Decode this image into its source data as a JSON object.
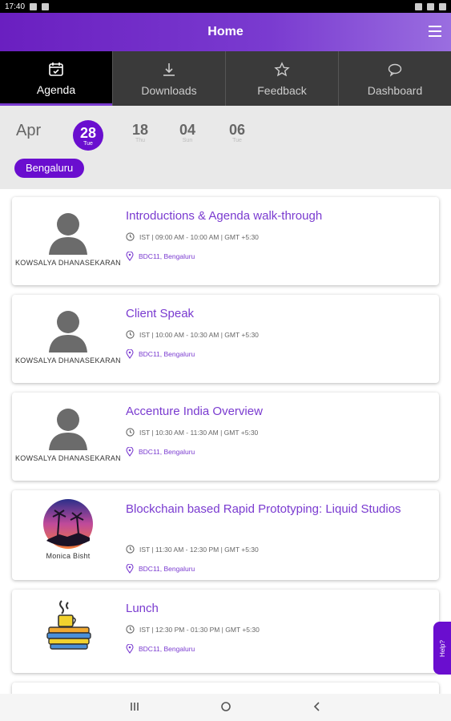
{
  "status_bar": {
    "time": "17:40"
  },
  "app_bar": {
    "title": "Home"
  },
  "tabs": [
    {
      "label": "Agenda",
      "icon": "calendar-icon",
      "active": true
    },
    {
      "label": "Downloads",
      "icon": "download-icon",
      "active": false
    },
    {
      "label": "Feedback",
      "icon": "star-icon",
      "active": false
    },
    {
      "label": "Dashboard",
      "icon": "chat-icon",
      "active": false
    }
  ],
  "dates": {
    "month": "Apr",
    "days": [
      {
        "num": "28",
        "dow": "Tue",
        "active": true
      },
      {
        "num": "18",
        "dow": "Thu",
        "active": false
      },
      {
        "num": "04",
        "dow": "Sun",
        "active": false
      },
      {
        "num": "06",
        "dow": "Tue",
        "active": false
      }
    ]
  },
  "location_chip": "Bengaluru",
  "sessions": [
    {
      "speaker": "KOWSALYA DHANASEKARAN",
      "title": "Introductions & Agenda walk-through",
      "time": "IST | 09:00 AM - 10:00 AM | GMT +5:30",
      "location": "BDC11, Bengaluru"
    },
    {
      "speaker": "KOWSALYA DHANASEKARAN",
      "title": "Client Speak",
      "time": "IST | 10:00 AM - 10:30 AM | GMT +5:30",
      "location": "BDC11, Bengaluru"
    },
    {
      "speaker": "KOWSALYA DHANASEKARAN",
      "title": "Accenture India Overview",
      "time": "IST | 10:30 AM - 11:30 AM | GMT +5:30",
      "location": "BDC11, Bengaluru"
    },
    {
      "speaker": "Monica Bisht",
      "title": "Blockchain based Rapid Prototyping: Liquid Studios",
      "time": "IST | 11:30 AM - 12:30 PM | GMT +5:30",
      "location": "BDC11, Bengaluru"
    },
    {
      "speaker": "",
      "title": "Lunch",
      "time": "IST | 12:30 PM - 01:30 PM | GMT +5:30",
      "location": "BDC11, Bengaluru"
    }
  ],
  "help_label": "Help?",
  "colors": {
    "accent": "#6a0ecf",
    "title_purple": "#7a3bd0",
    "tab_bar": "#3a3a3a"
  }
}
